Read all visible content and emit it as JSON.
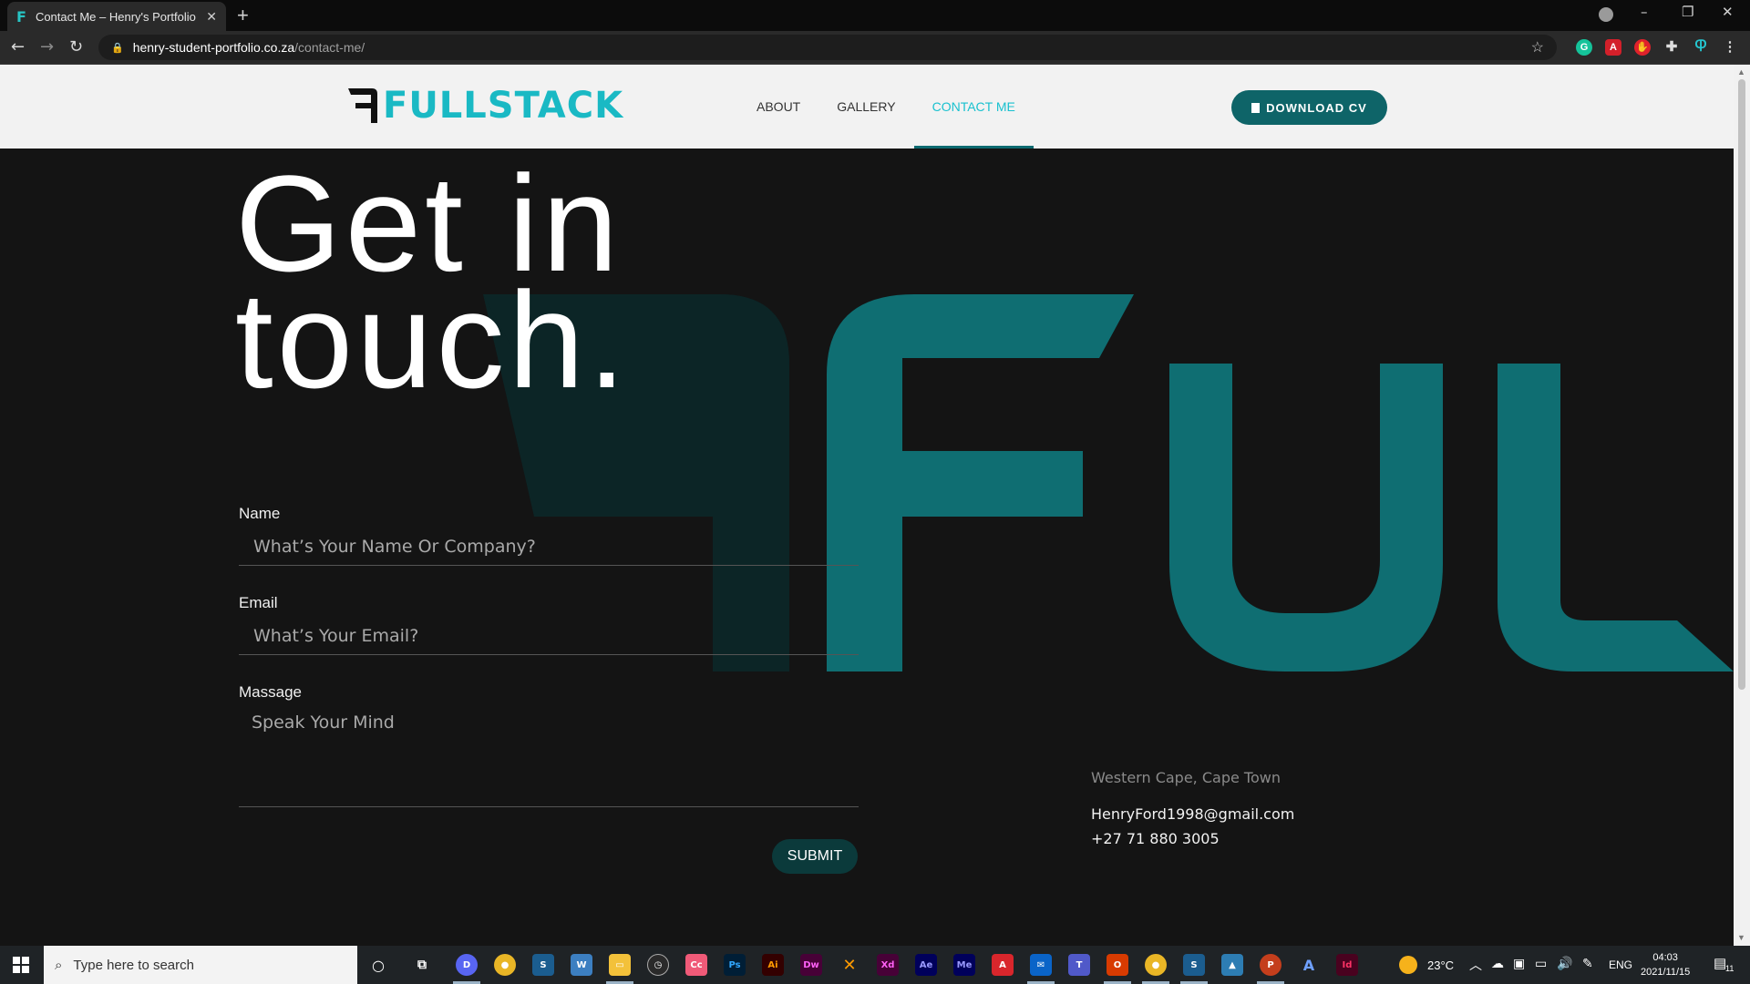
{
  "browser": {
    "tab_title": "Contact Me – Henry's Portfolio",
    "tab_favicon": "F",
    "url_host": "henry-student-portfolio.co.za",
    "url_path": "/contact-me/"
  },
  "header": {
    "logo_text": "FULLSTACK",
    "menu": [
      {
        "label": "ABOUT",
        "active": false
      },
      {
        "label": "GALLERY",
        "active": false
      },
      {
        "label": "CONTACT ME",
        "active": true
      }
    ],
    "cv_button": "DOWNLOAD CV"
  },
  "hero": {
    "line1": "Get in",
    "line2": "touch."
  },
  "form": {
    "name_label": "Name",
    "name_placeholder": "What’s Your Name Or Company?",
    "email_label": "Email",
    "email_placeholder": "What’s Your Email?",
    "message_label": "Massage",
    "message_placeholder": "Speak Your Mind",
    "submit_label": "SUBMIT"
  },
  "contact_info": {
    "location": "Western Cape, Cape Town",
    "email": "HenryFord1998@gmail.com",
    "phone": "+27 71 880 3005"
  },
  "taskbar": {
    "search_placeholder": "Type here to search",
    "weather": "23°C",
    "language": "ENG",
    "time": "04:03",
    "date": "2021/11/15",
    "notification_count": "11"
  },
  "colors": {
    "accent": "#1ab9c4",
    "teal_dark": "#0e6468",
    "teal_bg": "#0f6e72",
    "page_bg": "#141414"
  }
}
